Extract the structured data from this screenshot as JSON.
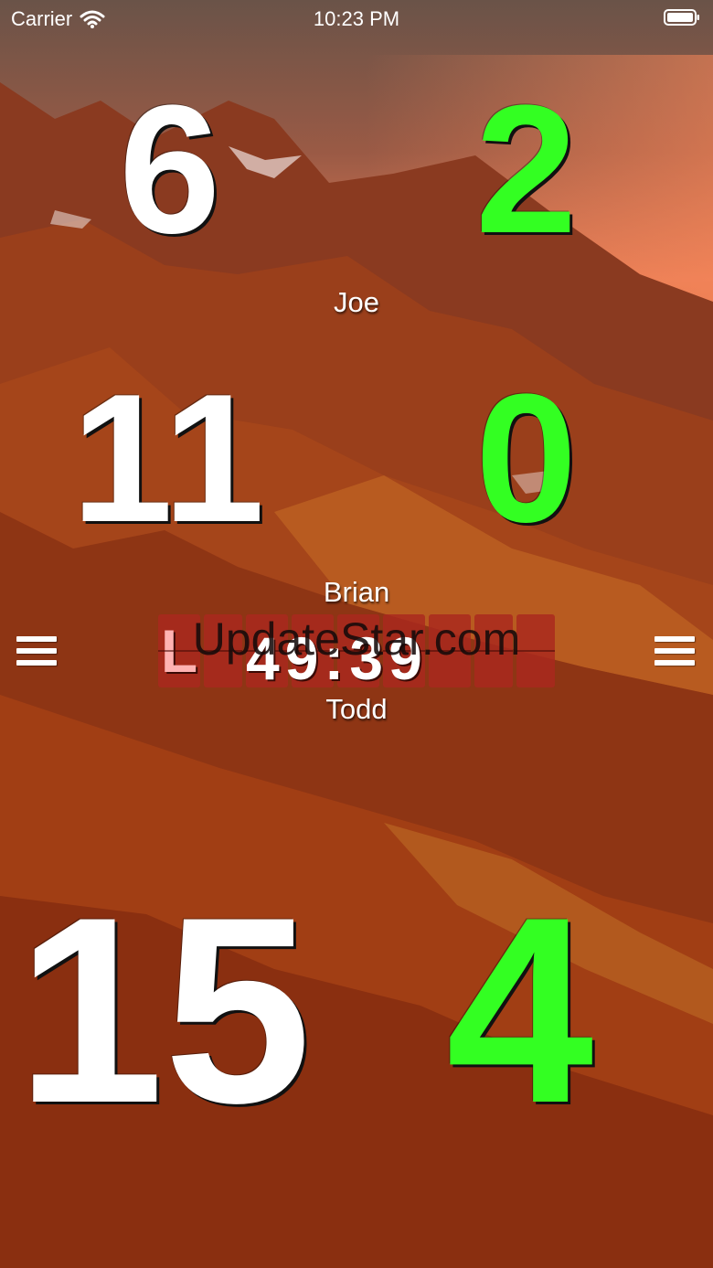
{
  "status_bar": {
    "carrier": "Carrier",
    "time": "10:23 PM"
  },
  "players": [
    {
      "name": "Joe",
      "score": "6",
      "secondary": "2"
    },
    {
      "name": "Brian",
      "score": "11",
      "secondary": "0"
    },
    {
      "name": "Todd",
      "score": "15",
      "secondary": "4"
    }
  ],
  "timer": {
    "prefix": "L",
    "value": "49:39"
  },
  "watermark": "UpdateStar.com",
  "colors": {
    "score_primary": "#ffffff",
    "score_secondary": "#33ff22",
    "timer_cell": "#aa281e"
  }
}
